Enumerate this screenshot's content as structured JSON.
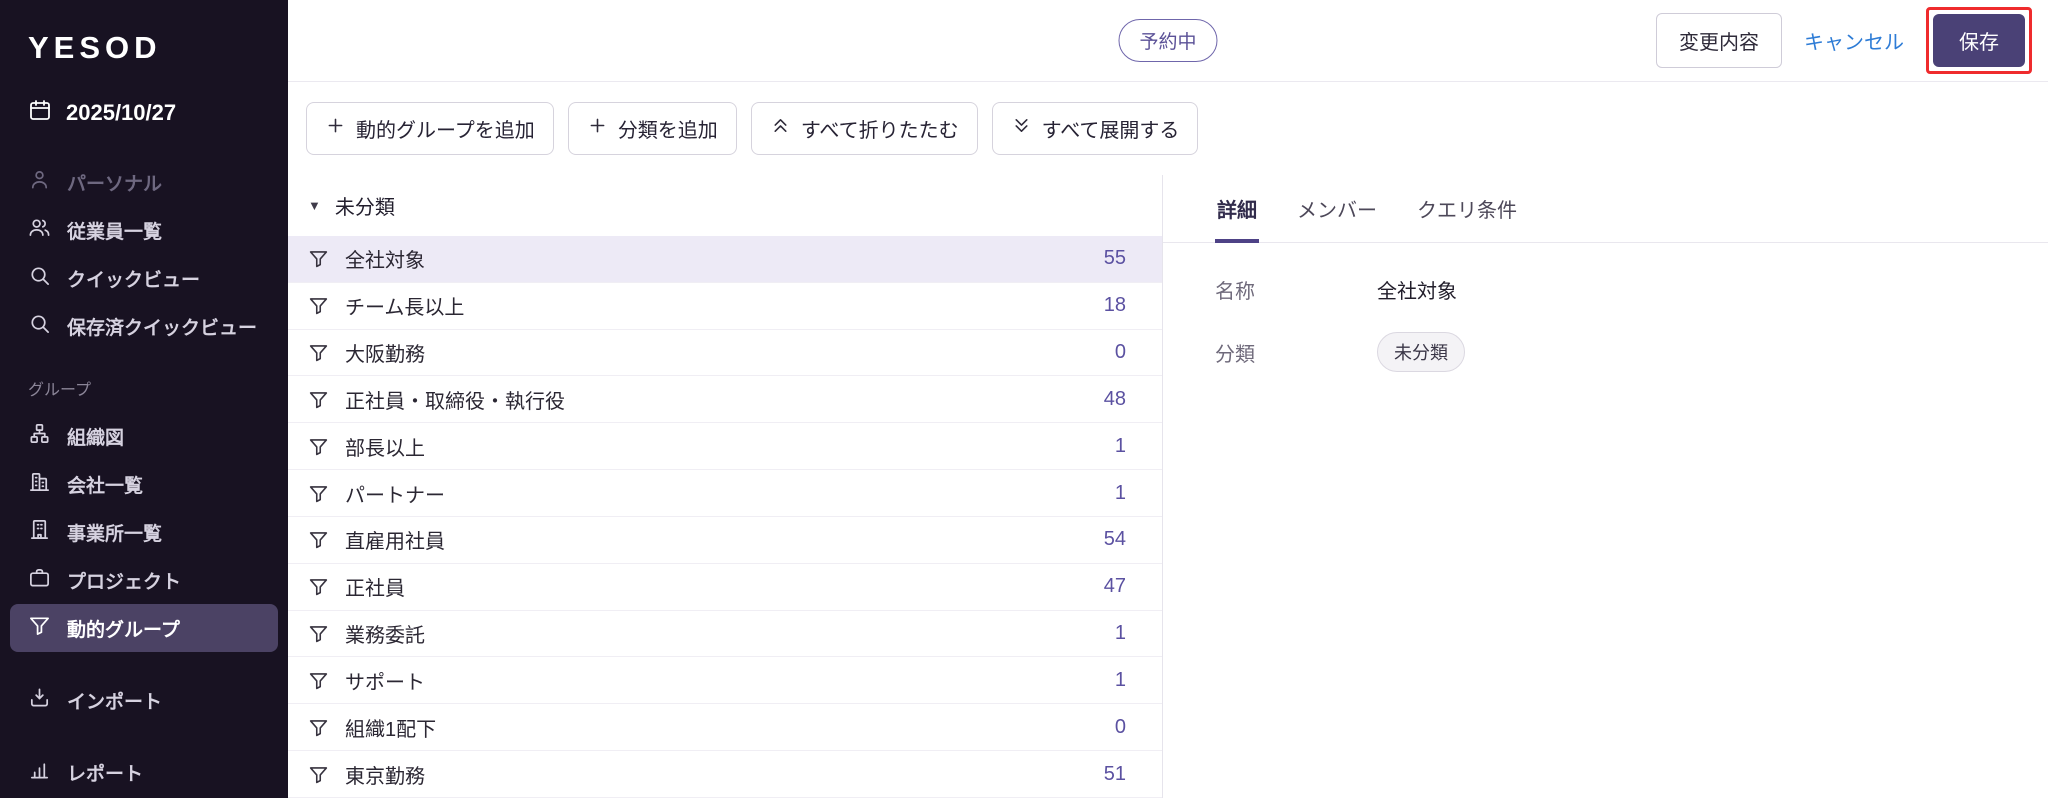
{
  "brand": {
    "logo": "YESOD"
  },
  "sidebar": {
    "date": "2025/10/27",
    "items": [
      {
        "label": "パーソナル",
        "icon": "person-icon"
      },
      {
        "label": "従業員一覧",
        "icon": "people-icon"
      },
      {
        "label": "クイックビュー",
        "icon": "search-icon"
      },
      {
        "label": "保存済クイックビュー",
        "icon": "search-icon"
      }
    ],
    "section": "グループ",
    "group_items": [
      {
        "label": "組織図",
        "icon": "sitemap-icon"
      },
      {
        "label": "会社一覧",
        "icon": "company-icon"
      },
      {
        "label": "事業所一覧",
        "icon": "office-icon"
      },
      {
        "label": "プロジェクト",
        "icon": "briefcase-icon"
      },
      {
        "label": "動的グループ",
        "icon": "funnel-icon",
        "selected": true
      }
    ],
    "bottom_items": [
      {
        "label": "インポート",
        "icon": "import-icon"
      },
      {
        "label": "レポート",
        "icon": "report-icon"
      }
    ]
  },
  "topbar": {
    "status_badge": "予約中",
    "changes_button": "変更内容",
    "cancel_link": "キャンセル",
    "save_button": "保存"
  },
  "toolbar": {
    "add_group": "動的グループを追加",
    "add_category": "分類を追加",
    "collapse_all": "すべて折りたたむ",
    "expand_all": "すべて展開する"
  },
  "list": {
    "group_header": "未分類",
    "rows": [
      {
        "label": "全社対象",
        "count": "55"
      },
      {
        "label": "チーム長以上",
        "count": "18"
      },
      {
        "label": "大阪勤務",
        "count": "0"
      },
      {
        "label": "正社員・取締役・執行役",
        "count": "48"
      },
      {
        "label": "部長以上",
        "count": "1"
      },
      {
        "label": "パートナー",
        "count": "1"
      },
      {
        "label": "直雇用社員",
        "count": "54"
      },
      {
        "label": "正社員",
        "count": "47"
      },
      {
        "label": "業務委託",
        "count": "1"
      },
      {
        "label": "サポート",
        "count": "1"
      },
      {
        "label": "組織1配下",
        "count": "0"
      },
      {
        "label": "東京勤務",
        "count": "51"
      }
    ]
  },
  "detail": {
    "tabs": [
      {
        "label": "詳細",
        "active": true
      },
      {
        "label": "メンバー"
      },
      {
        "label": "クエリ条件"
      }
    ],
    "fields": [
      {
        "label": "名称",
        "value": "全社対象"
      },
      {
        "label": "分類",
        "value": "未分類"
      }
    ]
  },
  "colors": {
    "sidebar_bg": "#181222",
    "sidebar_selected_bg": "#4b4264",
    "accent_purple": "#4a4176",
    "count_purple": "#5b51a1",
    "badge_purple": "#5b5197",
    "link_blue": "#2e7cd6",
    "annotation_red": "#ef2b2d",
    "selected_row_bg": "#edeaf6"
  }
}
